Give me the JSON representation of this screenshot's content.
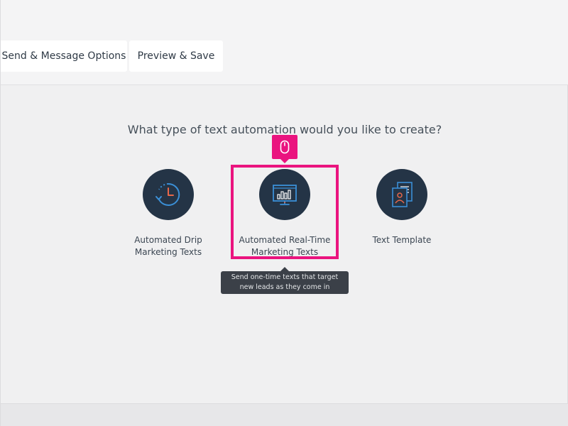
{
  "tabs": {
    "send_options": "Send & Message Options",
    "preview_save": "Preview & Save"
  },
  "question": "What type of text automation would you like to create?",
  "options": [
    {
      "line1": "Automated Drip",
      "line2": "Marketing Texts",
      "icon": "clock-icon"
    },
    {
      "line1": "Automated Real-Time",
      "line2": "Marketing Texts",
      "icon": "monitor-chart-icon"
    },
    {
      "line1": "Text Template",
      "line2": "",
      "icon": "document-template-icon"
    }
  ],
  "tooltip": {
    "line1": "Send one-time texts that target",
    "line2": "new leads as they come in"
  },
  "colors": {
    "icon_circle": "#243446",
    "accent_blue": "#3b8fd6",
    "accent_orange": "#e8684a",
    "highlight": "#ea147f",
    "tooltip_bg": "#3b4048"
  },
  "click_indicator_icon": "mouse-icon"
}
